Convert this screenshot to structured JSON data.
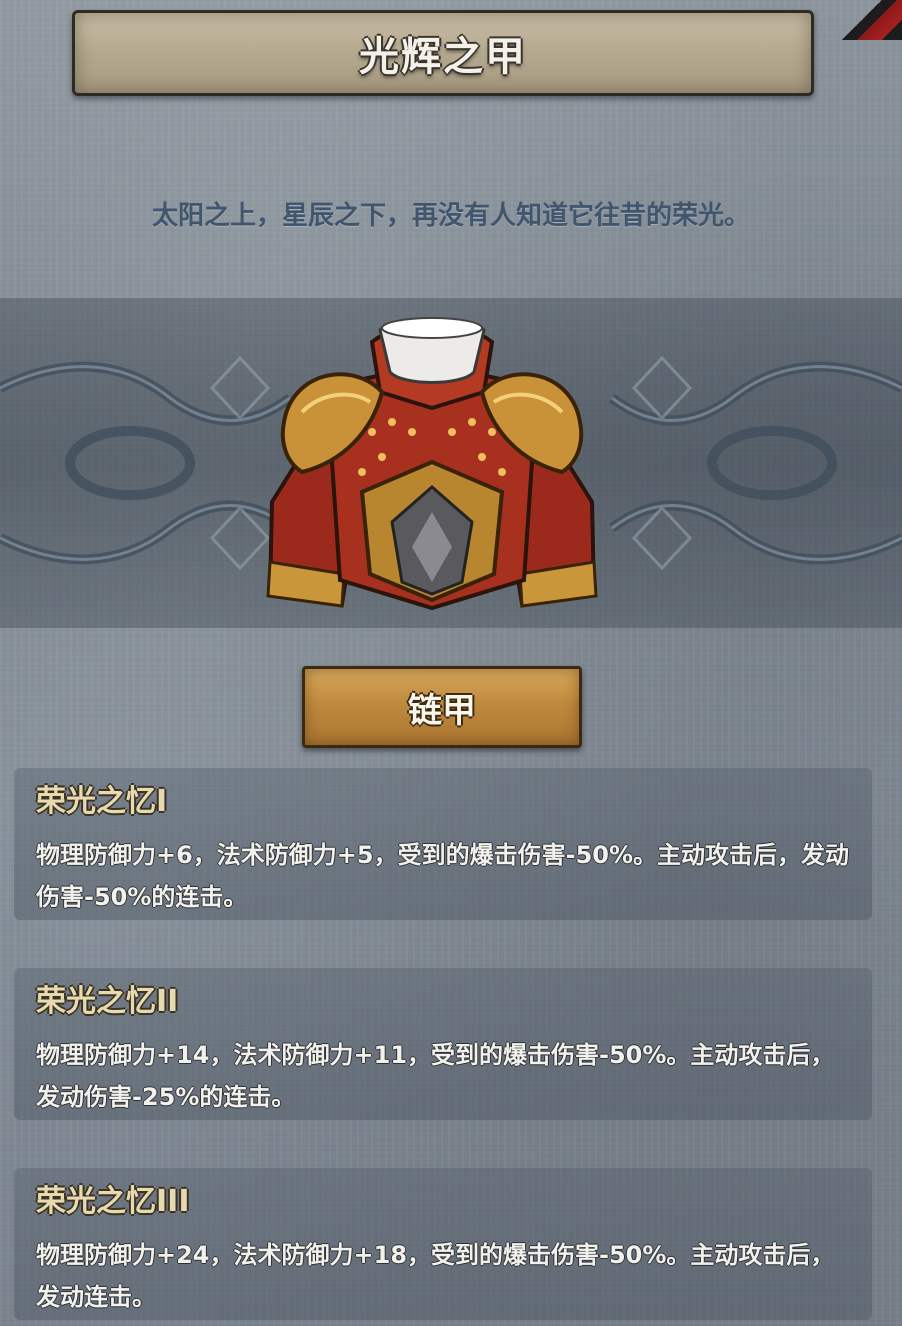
{
  "item": {
    "name": "光辉之甲",
    "flavor_text": "太阳之上，星辰之下，再没有人知道它往昔的荣光。",
    "type_label": "链甲",
    "image_icon": "chest-armor-icon"
  },
  "skills": [
    {
      "title": "荣光之忆I",
      "description": "物理防御力+6，法术防御力+5，受到的爆击伤害-50%。主动攻击后，发动伤害-50%的连击。"
    },
    {
      "title": "荣光之忆II",
      "description": "物理防御力+14，法术防御力+11，受到的爆击伤害-50%。主动攻击后，发动伤害-25%的连击。"
    },
    {
      "title": "荣光之忆III",
      "description": "物理防御力+24，法术防御力+18，受到的爆击伤害-50%。主动攻击后，发动连击。"
    }
  ],
  "colors": {
    "background": "#828b95",
    "title_banner": "#b4a98f",
    "type_button": "#c08a3e",
    "skill_title": "#e7d9b0",
    "flavor_text": "#40556e"
  }
}
